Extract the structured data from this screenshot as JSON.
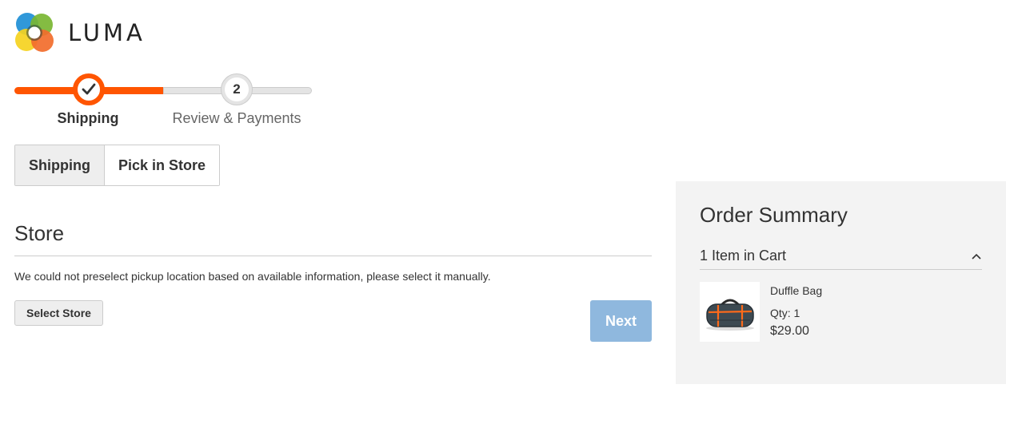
{
  "header": {
    "brand": "LUMA"
  },
  "progress": {
    "steps": [
      {
        "number": "",
        "label": "Shipping",
        "state": "complete"
      },
      {
        "number": "2",
        "label": "Review & Payments",
        "state": "pending"
      }
    ]
  },
  "shipping_method_tabs": [
    {
      "label": "Shipping",
      "active": true
    },
    {
      "label": "Pick in Store",
      "active": false
    }
  ],
  "store_section": {
    "title": "Store",
    "notice": "We could not preselect pickup location based on available information, please select it manually.",
    "select_store_label": "Select Store",
    "next_label": "Next"
  },
  "order_summary": {
    "title": "Order Summary",
    "items_in_cart": "1 Item in Cart",
    "items": [
      {
        "name": "Duffle Bag",
        "qty": "Qty: 1",
        "price": "$29.00"
      }
    ]
  },
  "colors": {
    "accent_orange": "#ff5501",
    "next_button_disabled": "#8fb8de",
    "summary_background": "#f3f3f3"
  },
  "icons": {
    "step_complete": "checkmark-icon",
    "collapse": "chevron-up-icon",
    "logo": "luma-logo-icon",
    "product_image": "duffle-bag-image"
  }
}
